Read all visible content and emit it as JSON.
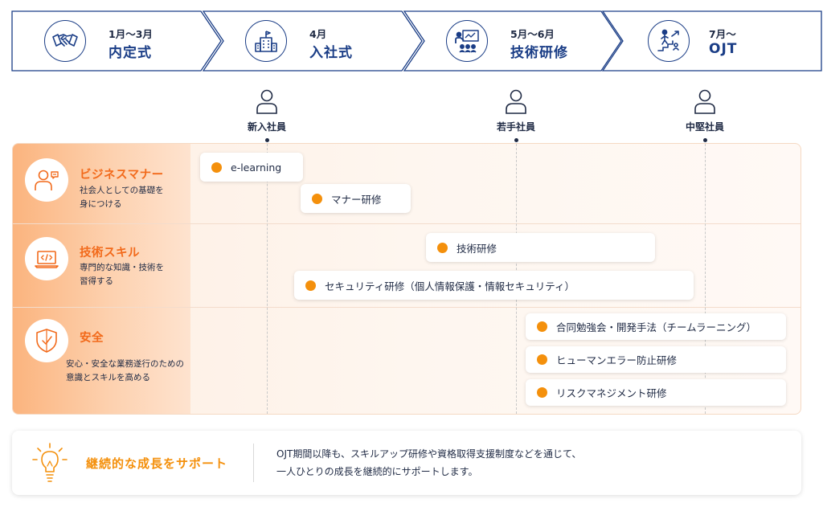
{
  "steps": [
    {
      "period": "1月〜3月",
      "title": "内定式",
      "icon": "handshake-icon"
    },
    {
      "period": "4月",
      "title": "入社式",
      "icon": "office-building-icon"
    },
    {
      "period": "5月〜6月",
      "title": "技術研修",
      "icon": "training-presentation-icon"
    },
    {
      "period": "7月〜",
      "title": "OJT",
      "icon": "career-stairs-icon"
    }
  ],
  "roles": [
    {
      "label": "新入社員",
      "icon": "person-icon"
    },
    {
      "label": "若手社員",
      "icon": "person-icon"
    },
    {
      "label": "中堅社員",
      "icon": "person-icon"
    }
  ],
  "categories": [
    {
      "name": "ビジネスマナー",
      "desc": [
        "社会人としての基礎を",
        "身につける"
      ],
      "icon": "speaking-person-icon",
      "trainings": [
        "e-learning",
        "マナー研修"
      ]
    },
    {
      "name": "技術スキル",
      "desc": [
        "専門的な知識・技術を",
        "習得する"
      ],
      "icon": "laptop-code-icon",
      "trainings": [
        "技術研修",
        "セキュリティ研修（個人情報保護・情報セキュリティ）"
      ]
    },
    {
      "name": "安全",
      "desc": [
        "安心・安全な業務遂行のための",
        "意識とスキルを高める"
      ],
      "icon": "shield-check-icon",
      "trainings": [
        "合同勉強会・開発手法（チームラーニング）",
        "ヒューマンエラー防止研修",
        "リスクマネジメント研修"
      ]
    }
  ],
  "support": {
    "title": "継続的な成長をサポート",
    "body": [
      "OJT期間以降も、スキルアップ研修や資格取得支援制度などを通じて、",
      "一人ひとりの成長を継続的にサポートします。"
    ],
    "icon": "lightbulb-icon"
  },
  "colors": {
    "navy": "#1a3d86",
    "orange_title": "#f26a1b",
    "bullet": "#f4900c"
  }
}
